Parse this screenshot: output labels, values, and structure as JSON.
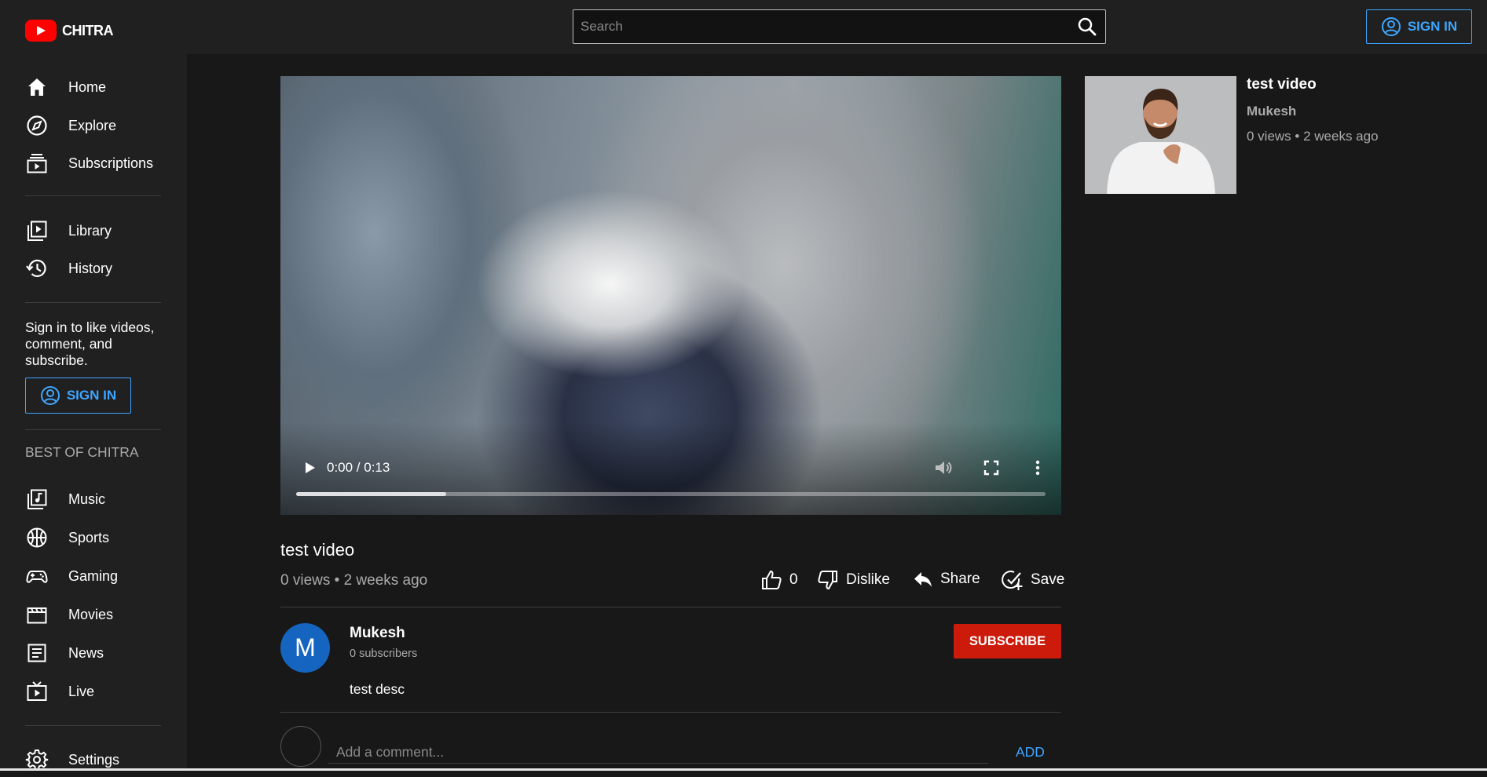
{
  "header": {
    "logo_text": "CHITRA",
    "search_placeholder": "Search",
    "signin_label": "SIGN IN"
  },
  "sidebar": {
    "items": [
      {
        "label": "Home",
        "icon": "home-icon"
      },
      {
        "label": "Explore",
        "icon": "compass-icon"
      },
      {
        "label": "Subscriptions",
        "icon": "subscriptions-icon"
      },
      {
        "label": "Library",
        "icon": "library-icon"
      },
      {
        "label": "History",
        "icon": "history-icon"
      }
    ],
    "signin_note": "Sign in to like videos, comment, and subscribe.",
    "signin_label": "SIGN IN",
    "best_heading": "BEST OF CHITRA",
    "best_items": [
      {
        "label": "Music",
        "icon": "music-icon"
      },
      {
        "label": "Sports",
        "icon": "sports-icon"
      },
      {
        "label": "Gaming",
        "icon": "gaming-icon"
      },
      {
        "label": "Movies",
        "icon": "movies-icon"
      },
      {
        "label": "News",
        "icon": "news-icon"
      },
      {
        "label": "Live",
        "icon": "live-icon"
      }
    ],
    "settings_label": "Settings"
  },
  "player": {
    "time": "0:00 / 0:13",
    "progress_fraction": 0.2
  },
  "video": {
    "title": "test video",
    "meta": "0 views • 2 weeks ago",
    "likes": "0",
    "dislike_label": "Dislike",
    "share_label": "Share",
    "save_label": "Save"
  },
  "channel": {
    "avatar_letter": "M",
    "name": "Mukesh",
    "subscribers": "0 subscribers",
    "subscribe_label": "SUBSCRIBE",
    "description": "test desc"
  },
  "comments": {
    "placeholder": "Add a comment...",
    "add_label": "ADD"
  },
  "related": [
    {
      "title": "test video",
      "channel": "Mukesh",
      "meta": "0 views • 2 weeks ago"
    }
  ],
  "colors": {
    "accent": "#3ea6ff",
    "subscribe": "#cc1a0b",
    "logo": "#ff0000",
    "avatar": "#1565c0"
  }
}
